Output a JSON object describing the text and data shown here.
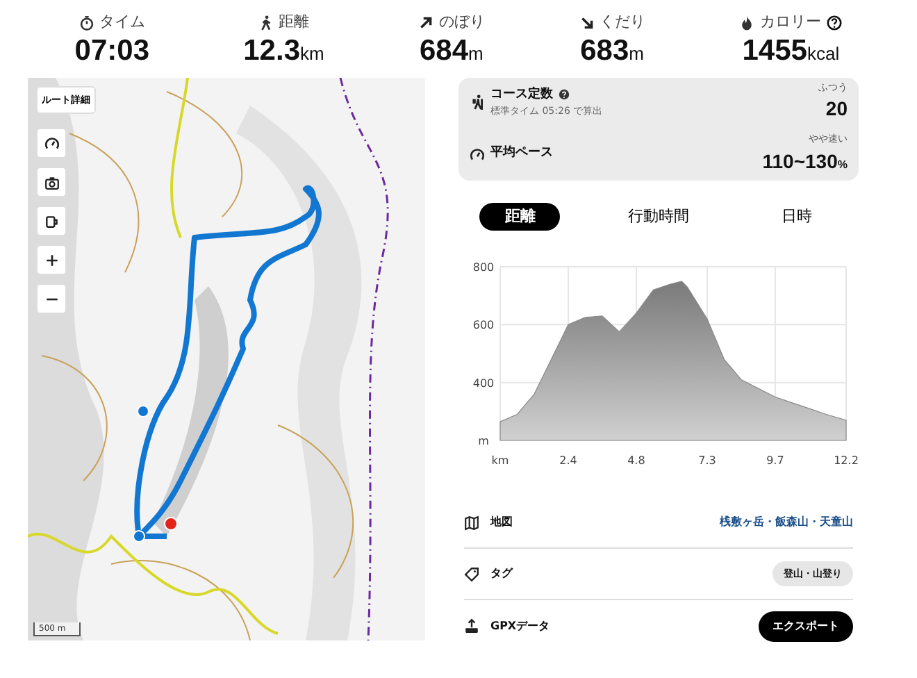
{
  "stats": [
    {
      "kind": "time",
      "label": "タイム",
      "value": "07:03"
    },
    {
      "kind": "distance",
      "label": "距離",
      "value": "12.3",
      "unit": "km"
    },
    {
      "kind": "up",
      "label": "のぼり",
      "value": "684",
      "unit": "m"
    },
    {
      "kind": "down",
      "label": "くだり",
      "value": "683",
      "unit": "m"
    },
    {
      "kind": "calorie",
      "label": "カロリー",
      "value": "1455",
      "unit": "kcal",
      "help": true
    }
  ],
  "map": {
    "kind": "picture",
    "route_button": "ルート詳細",
    "scale": "500 m"
  },
  "summary": [
    {
      "kind": "course",
      "label": "コース定数",
      "help": true,
      "note": "標準タイム 05:26 で算出",
      "rating": "ふつう",
      "value": "20"
    },
    {
      "kind": "pace",
      "label": "平均ペース",
      "rating": "やや速い",
      "value": "110~130",
      "unit": "%"
    }
  ],
  "tabs": [
    {
      "label": "距離",
      "selected": true
    },
    {
      "label": "行動時間",
      "selected": false
    },
    {
      "label": "日時",
      "selected": false
    }
  ],
  "chart_data": {
    "type": "area",
    "x": [
      0,
      0.6,
      1.2,
      1.8,
      2.4,
      3.0,
      3.6,
      4.2,
      4.8,
      5.4,
      6.0,
      6.4,
      6.6,
      7.3,
      7.9,
      8.5,
      9.1,
      9.7,
      10.3,
      10.9,
      11.5,
      12.2
    ],
    "grid": true,
    "series": [
      {
        "color": "#8a8a8a",
        "values": [
          265,
          290,
          360,
          480,
          600,
          625,
          630,
          575,
          640,
          720,
          740,
          750,
          730,
          620,
          480,
          410,
          380,
          350,
          330,
          310,
          290,
          270
        ]
      }
    ],
    "xlim": [
      0,
      12.2
    ],
    "ylim": [
      200,
      800
    ],
    "xticks": [
      {
        "value": 0,
        "label": "km"
      },
      2.4,
      4.8,
      7.3,
      9.7,
      12.2
    ],
    "yticks": [
      {
        "value": 200,
        "label": "m"
      },
      400,
      600,
      800
    ]
  },
  "info": [
    {
      "kind": "map",
      "label": "地図",
      "link": "桟敷ヶ岳・飯森山・天童山"
    },
    {
      "kind": "tag",
      "label": "タグ",
      "tag": "登山・山登り"
    },
    {
      "kind": "gpx",
      "label": "GPXデータ",
      "button": "エクスポート"
    }
  ]
}
